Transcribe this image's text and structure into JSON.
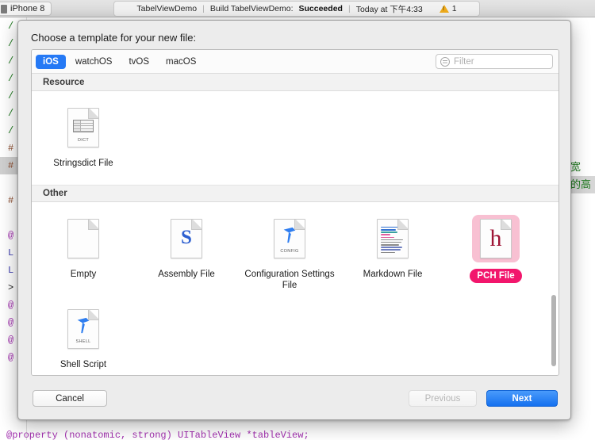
{
  "toolbar": {
    "scheme": "iPhone 8",
    "scheme_icon": "device-icon",
    "project": "TabelViewDemo",
    "separator": "|",
    "build_prefix": "Build TabelViewDemo:",
    "build_result": "Succeeded",
    "timestamp": "Today at 下午4:33",
    "warning_icon": "warning-triangle-icon",
    "warning_count": "1"
  },
  "sheet": {
    "title": "Choose a template for your new file:",
    "tabs": [
      {
        "label": "iOS",
        "active": true
      },
      {
        "label": "watchOS",
        "active": false
      },
      {
        "label": "tvOS",
        "active": false
      },
      {
        "label": "macOS",
        "active": false
      }
    ],
    "filter": {
      "icon": "filter-icon",
      "placeholder": "Filter",
      "value": ""
    },
    "groups": [
      {
        "title": "Resource",
        "items": [
          {
            "label": "Stringsdict File",
            "icon": "dict-document-icon",
            "tag": "DICT",
            "selected": false
          }
        ]
      },
      {
        "title": "Other",
        "items": [
          {
            "label": "Empty",
            "icon": "blank-document-icon",
            "tag": "",
            "selected": false
          },
          {
            "label": "Assembly File",
            "icon": "assembly-document-icon",
            "tag": "",
            "selected": false
          },
          {
            "label": "Configuration Settings File",
            "icon": "config-document-icon",
            "tag": "CONFIG",
            "selected": false
          },
          {
            "label": "Markdown File",
            "icon": "markdown-document-icon",
            "tag": "",
            "selected": false
          },
          {
            "label": "PCH File",
            "icon": "pch-document-icon",
            "tag": "",
            "selected": true
          },
          {
            "label": "Shell Script",
            "icon": "shell-document-icon",
            "tag": "SHELL",
            "selected": false
          }
        ]
      }
    ],
    "scrollbar": "vertical-scrollbar",
    "buttons": {
      "cancel": "Cancel",
      "previous": "Previous",
      "next": "Next"
    }
  },
  "background_editor": {
    "left_gutter_lines": [
      {
        "text": "/",
        "color": "green",
        "highlight": false
      },
      {
        "text": "/",
        "color": "green",
        "highlight": false
      },
      {
        "text": "/",
        "color": "green",
        "highlight": false
      },
      {
        "text": "/",
        "color": "green",
        "highlight": false
      },
      {
        "text": "/",
        "color": "green",
        "highlight": false
      },
      {
        "text": "/",
        "color": "green",
        "highlight": false
      },
      {
        "text": "/",
        "color": "green",
        "highlight": false
      },
      {
        "text": "#",
        "color": "brown",
        "highlight": false
      },
      {
        "text": "#",
        "color": "brown",
        "highlight": true
      },
      {
        "text": "",
        "color": "black",
        "highlight": false
      },
      {
        "text": "#",
        "color": "brown",
        "highlight": false
      },
      {
        "text": "",
        "color": "black",
        "highlight": false
      },
      {
        "text": "@",
        "color": "purple",
        "highlight": false
      },
      {
        "text": "L",
        "color": "blue",
        "highlight": false
      },
      {
        "text": "L",
        "color": "blue",
        "highlight": false
      },
      {
        "text": ">",
        "color": "black",
        "highlight": false
      },
      {
        "text": "@",
        "color": "purple",
        "highlight": false
      },
      {
        "text": "@",
        "color": "purple",
        "highlight": false
      },
      {
        "text": "@",
        "color": "purple",
        "highlight": false
      },
      {
        "text": "@",
        "color": "purple",
        "highlight": false
      }
    ],
    "right_comment_lines": [
      {
        "text": "的宽",
        "highlight": false
      },
      {
        "text": "幕的高",
        "highlight": true
      }
    ],
    "bottom_line": "@property (nonatomic, strong) UITableView *tableView;"
  },
  "colors": {
    "accent_blue": "#2579f5",
    "selection_pink": "#f2166c",
    "selection_pink_light": "#f8c0d2",
    "warning_yellow": "#f2ae1c",
    "comment_green": "#1f7a1f"
  }
}
